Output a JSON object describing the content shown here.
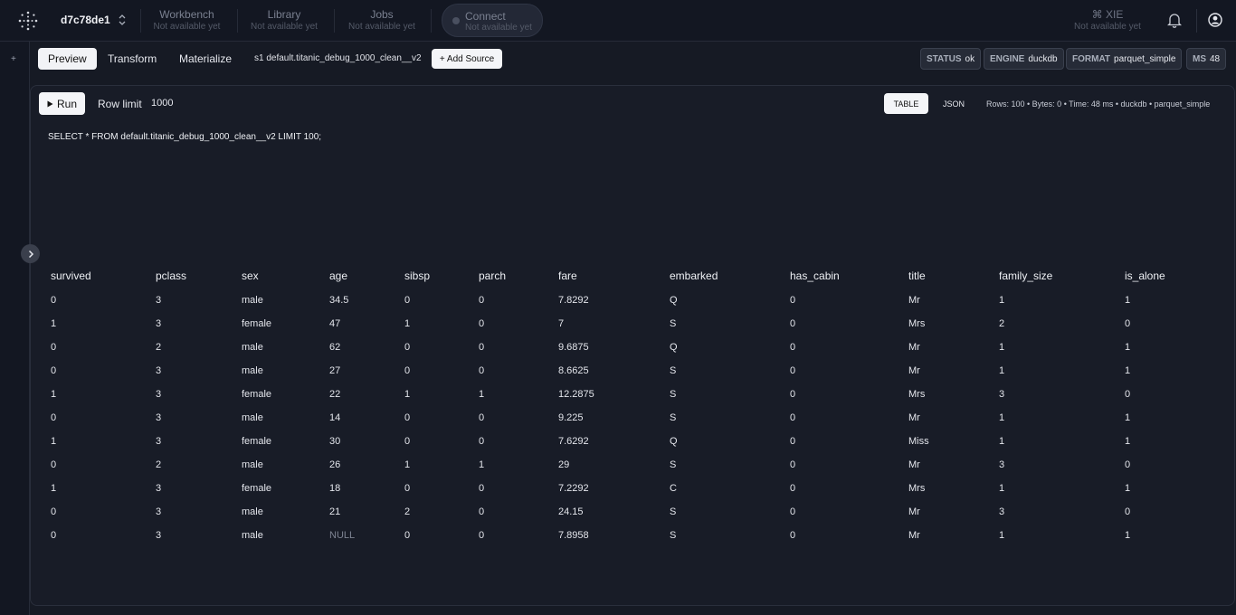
{
  "header": {
    "workspace": "d7c78de1",
    "nav": [
      {
        "title": "Workbench",
        "sub": "Not available yet"
      },
      {
        "title": "Library",
        "sub": "Not available yet"
      },
      {
        "title": "Jobs",
        "sub": "Not available yet"
      }
    ],
    "connect": {
      "title": "Connect",
      "sub": "Not available yet"
    },
    "xie": {
      "title": "⌘ XIE",
      "sub": "Not available yet"
    }
  },
  "rail": {
    "plus": "+"
  },
  "toolbar": {
    "tabs": [
      "Preview",
      "Transform",
      "Materialize"
    ],
    "active_tab": "Preview",
    "source_label": "s1 default.titanic_debug_1000_clean__v2",
    "add_source": "+ Add Source",
    "badges": [
      {
        "key": "STATUS",
        "value": "ok"
      },
      {
        "key": "ENGINE",
        "value": "duckdb"
      },
      {
        "key": "FORMAT",
        "value": "parquet_simple"
      },
      {
        "key": "MS",
        "value": "48"
      }
    ]
  },
  "query": {
    "run_label": "Run",
    "row_limit_label": "Row limit",
    "row_limit_value": "1000",
    "view_table": "TABLE",
    "view_json": "JSON",
    "meta": "Rows: 100 • Bytes: 0 • Time: 48 ms • duckdb • parquet_simple",
    "sql": "SELECT * FROM default.titanic_debug_1000_clean__v2 LIMIT 100;"
  },
  "table": {
    "columns": [
      "survived",
      "pclass",
      "sex",
      "age",
      "sibsp",
      "parch",
      "fare",
      "embarked",
      "has_cabin",
      "title",
      "family_size",
      "is_alone"
    ],
    "rows": [
      [
        "0",
        "3",
        "male",
        "34.5",
        "0",
        "0",
        "7.8292",
        "Q",
        "0",
        "Mr",
        "1",
        "1"
      ],
      [
        "1",
        "3",
        "female",
        "47",
        "1",
        "0",
        "7",
        "S",
        "0",
        "Mrs",
        "2",
        "0"
      ],
      [
        "0",
        "2",
        "male",
        "62",
        "0",
        "0",
        "9.6875",
        "Q",
        "0",
        "Mr",
        "1",
        "1"
      ],
      [
        "0",
        "3",
        "male",
        "27",
        "0",
        "0",
        "8.6625",
        "S",
        "0",
        "Mr",
        "1",
        "1"
      ],
      [
        "1",
        "3",
        "female",
        "22",
        "1",
        "1",
        "12.2875",
        "S",
        "0",
        "Mrs",
        "3",
        "0"
      ],
      [
        "0",
        "3",
        "male",
        "14",
        "0",
        "0",
        "9.225",
        "S",
        "0",
        "Mr",
        "1",
        "1"
      ],
      [
        "1",
        "3",
        "female",
        "30",
        "0",
        "0",
        "7.6292",
        "Q",
        "0",
        "Miss",
        "1",
        "1"
      ],
      [
        "0",
        "2",
        "male",
        "26",
        "1",
        "1",
        "29",
        "S",
        "0",
        "Mr",
        "3",
        "0"
      ],
      [
        "1",
        "3",
        "female",
        "18",
        "0",
        "0",
        "7.2292",
        "C",
        "0",
        "Mrs",
        "1",
        "1"
      ],
      [
        "0",
        "3",
        "male",
        "21",
        "2",
        "0",
        "24.15",
        "S",
        "0",
        "Mr",
        "3",
        "0"
      ],
      [
        "0",
        "3",
        "male",
        "NULL",
        "0",
        "0",
        "7.8958",
        "S",
        "0",
        "Mr",
        "1",
        "1"
      ]
    ]
  }
}
